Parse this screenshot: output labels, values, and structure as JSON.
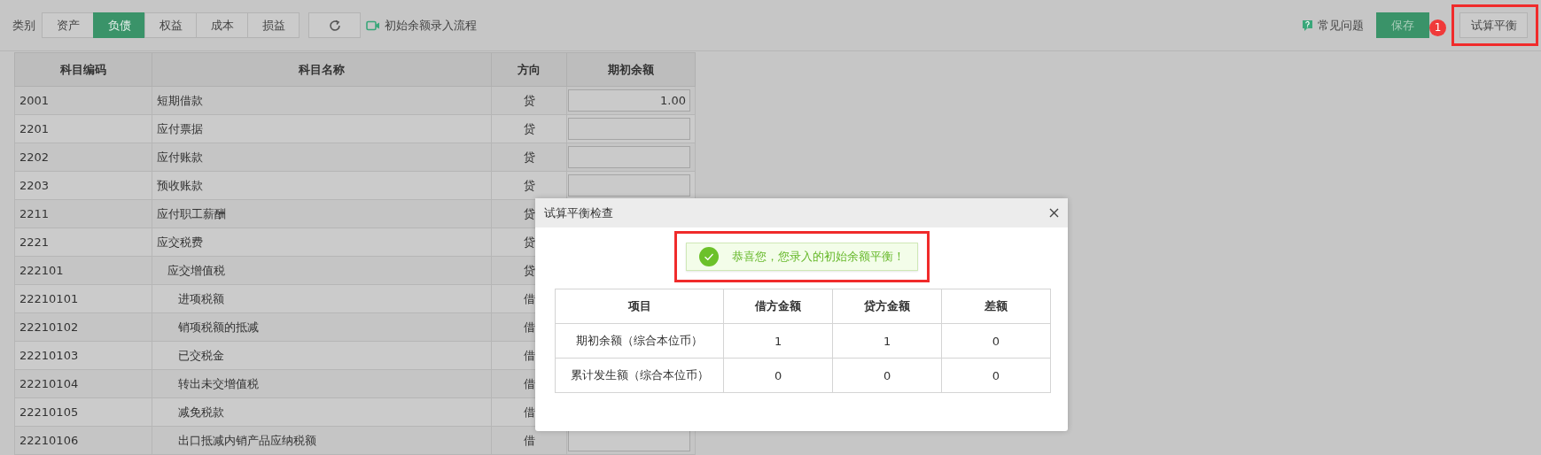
{
  "toolbar": {
    "category_label": "类别",
    "tabs": [
      {
        "label": "资产",
        "selected": false
      },
      {
        "label": "负债",
        "selected": true
      },
      {
        "label": "权益",
        "selected": false
      },
      {
        "label": "成本",
        "selected": false
      },
      {
        "label": "损益",
        "selected": false
      }
    ],
    "flow_link": "初始余额录入流程",
    "help_link": "常见问题",
    "save_button": {
      "label": "保存",
      "badge": "1"
    },
    "trial_button": {
      "label": "试算平衡",
      "highlighted": true
    }
  },
  "table": {
    "columns": [
      "科目编码",
      "科目名称",
      "方向",
      "期初余额"
    ],
    "rows": [
      {
        "code": "2001",
        "name": "短期借款",
        "direction": "贷",
        "amount": "1.00"
      },
      {
        "code": "2201",
        "name": "应付票据",
        "direction": "贷"
      },
      {
        "code": "2202",
        "name": "应付账款",
        "direction": "贷"
      },
      {
        "code": "2203",
        "name": "预收账款",
        "direction": "贷"
      },
      {
        "code": "2211",
        "name": "应付职工薪酬",
        "direction": "贷",
        "field": false
      },
      {
        "code": "2221",
        "name": "应交税费",
        "direction": "贷",
        "field": false,
        "children": [
          {
            "code": "222101",
            "name": "应交增值税",
            "direction": "贷",
            "field": false,
            "children": [
              {
                "code": "22210101",
                "name": "进项税额",
                "direction": "借",
                "field": false
              },
              {
                "code": "22210102",
                "name": "销项税额的抵减",
                "direction": "借",
                "field": false
              },
              {
                "code": "22210103",
                "name": "已交税金",
                "direction": "借",
                "field": false
              },
              {
                "code": "22210104",
                "name": "转出未交增值税",
                "direction": "借",
                "field": false
              },
              {
                "code": "22210105",
                "name": "减免税款",
                "direction": "借",
                "field": false
              },
              {
                "code": "22210106",
                "name": "出口抵减内销产品应纳税额",
                "direction": "借"
              }
            ]
          }
        ]
      }
    ]
  },
  "dialog": {
    "title": "试算平衡检查",
    "message": {
      "text": "恭喜您，您录入的初始余额平衡！",
      "highlighted": true
    },
    "columns": [
      "项目",
      "借方金额",
      "贷方金额",
      "差额"
    ],
    "rows": [
      [
        "期初余额（综合本位币）",
        "1",
        "1",
        "0"
      ],
      [
        "累计发生额（综合本位币）",
        "0",
        "0",
        "0"
      ]
    ]
  }
}
